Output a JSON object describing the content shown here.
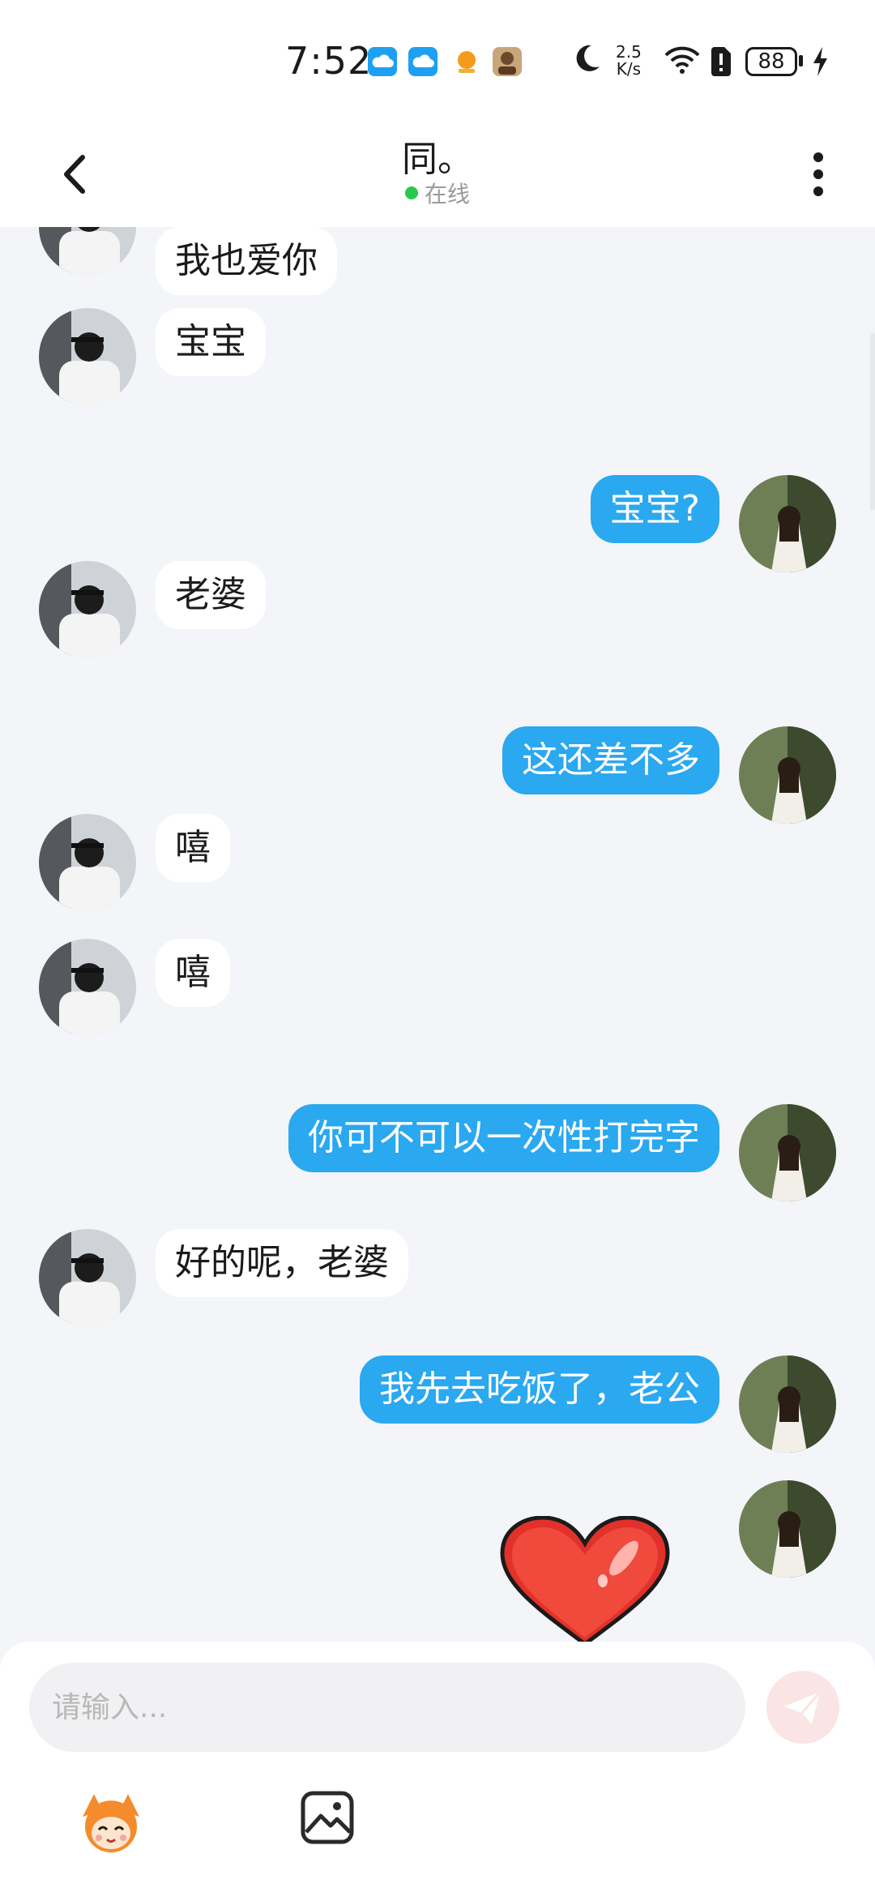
{
  "status_bar": {
    "time": "7:52",
    "net_speed_value": "2.5",
    "net_speed_unit": "K/s",
    "battery": "88",
    "icons": [
      "cloud-app-icon",
      "cloud-app-icon",
      "game-app-icon",
      "game-avatar-icon",
      "moon-icon",
      "wifi-icon",
      "sim-alert-icon",
      "battery-icon",
      "charging-icon"
    ]
  },
  "header": {
    "title": "同。",
    "status": "在线",
    "icons": [
      "back-arrow-icon",
      "more-vertical-icon"
    ]
  },
  "messages": [
    {
      "side": "left",
      "text": "我也爱你"
    },
    {
      "side": "left",
      "text": "宝宝"
    },
    {
      "side": "right",
      "text": "宝宝?"
    },
    {
      "side": "left",
      "text": "老婆"
    },
    {
      "side": "right",
      "text": "这还差不多"
    },
    {
      "side": "left",
      "text": "嘻"
    },
    {
      "side": "left",
      "text": "嘻"
    },
    {
      "side": "right",
      "text": "你可不可以一次性打完字"
    },
    {
      "side": "left",
      "text": "好的呢，老婆"
    },
    {
      "side": "right",
      "text": "我先去吃饭了，老公"
    },
    {
      "side": "right",
      "sticker": "red-heart"
    }
  ],
  "input": {
    "placeholder": "请输入..."
  },
  "colors": {
    "own_bubble": "#2aa8f0",
    "other_bubble": "#ffffff",
    "background": "#f3f5f9",
    "online": "#2ac84a",
    "send_button": "#fbe4e4",
    "heart": "#e2312a"
  }
}
